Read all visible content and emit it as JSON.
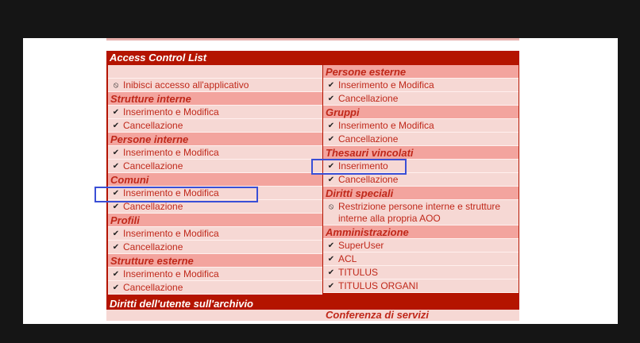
{
  "acl": {
    "title": "Access Control List",
    "bottom_title": "Diritti dell'utente sull'archivio",
    "bottom_right_section": "Conferenza di servizi",
    "left_rows": [
      {
        "kind": "blank"
      },
      {
        "kind": "item",
        "icon": "forbidden-icon",
        "glyph": "⦸",
        "label": "Inibisci accesso all'applicativo"
      },
      {
        "kind": "section",
        "label": "Strutture interne"
      },
      {
        "kind": "item",
        "icon": "check-icon",
        "glyph": "✔",
        "label": "Inserimento e Modifica"
      },
      {
        "kind": "item",
        "icon": "check-icon",
        "glyph": "✔",
        "label": "Cancellazione"
      },
      {
        "kind": "section",
        "label": "Persone interne"
      },
      {
        "kind": "item",
        "icon": "check-icon",
        "glyph": "✔",
        "label": "Inserimento e Modifica"
      },
      {
        "kind": "item",
        "icon": "check-icon",
        "glyph": "✔",
        "label": "Cancellazione"
      },
      {
        "kind": "section",
        "label": "Comuni"
      },
      {
        "kind": "item",
        "icon": "check-icon",
        "glyph": "✔",
        "label": "Inserimento e Modifica"
      },
      {
        "kind": "item",
        "icon": "check-icon",
        "glyph": "✔",
        "label": "Cancellazione"
      },
      {
        "kind": "section",
        "label": "Profili"
      },
      {
        "kind": "item",
        "icon": "check-icon",
        "glyph": "✔",
        "label": "Inserimento e Modifica"
      },
      {
        "kind": "item",
        "icon": "check-icon",
        "glyph": "✔",
        "label": "Cancellazione"
      },
      {
        "kind": "section",
        "label": "Strutture esterne"
      },
      {
        "kind": "item",
        "icon": "check-icon",
        "glyph": "✔",
        "label": "Inserimento e Modifica"
      },
      {
        "kind": "item",
        "icon": "check-icon",
        "glyph": "✔",
        "label": "Cancellazione"
      }
    ],
    "right_rows": [
      {
        "kind": "section",
        "label": "Persone esterne"
      },
      {
        "kind": "item",
        "icon": "check-icon",
        "glyph": "✔",
        "label": "Inserimento e Modifica"
      },
      {
        "kind": "item",
        "icon": "check-icon",
        "glyph": "✔",
        "label": "Cancellazione"
      },
      {
        "kind": "section",
        "label": "Gruppi"
      },
      {
        "kind": "item",
        "icon": "check-icon",
        "glyph": "✔",
        "label": "Inserimento e Modifica"
      },
      {
        "kind": "item",
        "icon": "check-icon",
        "glyph": "✔",
        "label": "Cancellazione"
      },
      {
        "kind": "section",
        "label": "Thesauri vincolati"
      },
      {
        "kind": "item",
        "icon": "check-icon",
        "glyph": "✔",
        "label": "Inserimento"
      },
      {
        "kind": "item",
        "icon": "check-icon",
        "glyph": "✔",
        "label": "Cancellazione"
      },
      {
        "kind": "section",
        "label": "Diritti speciali"
      },
      {
        "kind": "item-tall",
        "icon": "forbidden-icon",
        "glyph": "⦸",
        "label": "Restrizione persone interne e strutture interne alla propria AOO"
      },
      {
        "kind": "section",
        "label": "Amministrazione"
      },
      {
        "kind": "item",
        "icon": "check-icon",
        "glyph": "✔",
        "label": "SuperUser"
      },
      {
        "kind": "item",
        "icon": "check-icon",
        "glyph": "✔",
        "label": "ACL"
      },
      {
        "kind": "item",
        "icon": "check-icon",
        "glyph": "✔",
        "label": "TITULUS"
      },
      {
        "kind": "item",
        "icon": "check-icon",
        "glyph": "✔",
        "label": "TITULUS ORGANI"
      }
    ]
  },
  "colors": {
    "header_bg": "#b41400",
    "section_bg": "#f3a49e",
    "row_bg": "#f6d8d4",
    "text": "#c0281a",
    "highlight": "#3a4fd6"
  }
}
